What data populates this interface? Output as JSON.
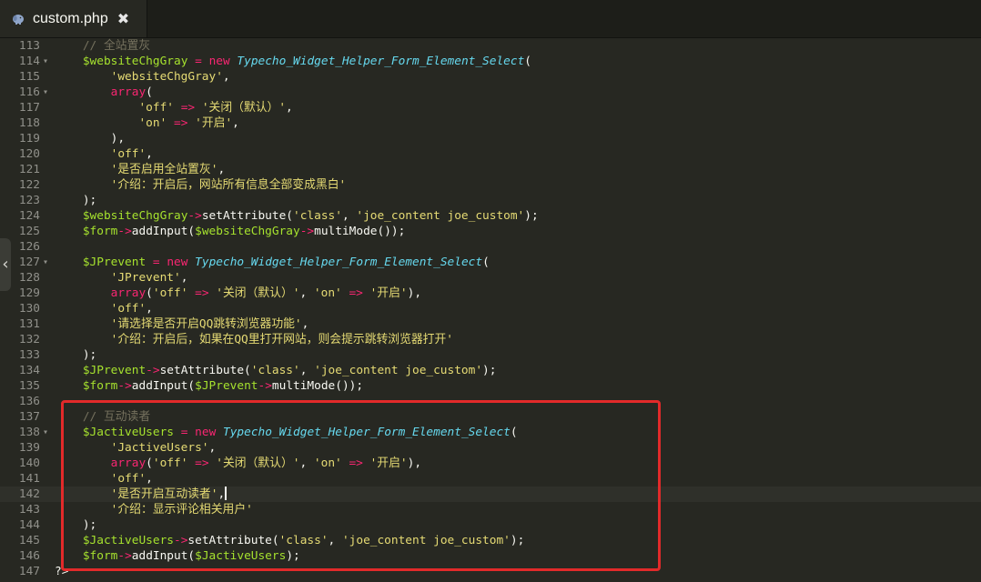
{
  "tab": {
    "title": "custom.php",
    "close": "✖",
    "icon": "php-elephant-icon"
  },
  "collapse_handle": "‹",
  "colors": {
    "background": "#272822",
    "comment": "#75715e",
    "variable": "#a6e22e",
    "keyword": "#f92672",
    "class": "#66d9ef",
    "string": "#e6db74",
    "highlight_box": "#e22a2a"
  },
  "highlight": {
    "from_line": 137,
    "to_line": 146
  },
  "cursor_line": 142,
  "lines": [
    {
      "num": "113",
      "fold": "",
      "tokens": [
        [
          "",
          "    "
        ],
        [
          "cmt",
          "// 全站置灰"
        ]
      ]
    },
    {
      "num": "114",
      "fold": "▾",
      "tokens": [
        [
          "",
          "    "
        ],
        [
          "var",
          "$websiteChgGray"
        ],
        [
          "",
          " "
        ],
        [
          "kw",
          "="
        ],
        [
          "",
          " "
        ],
        [
          "kw",
          "new"
        ],
        [
          "",
          " "
        ],
        [
          "cls",
          "Typecho_Widget_Helper_Form_Element_Select"
        ],
        [
          "",
          "("
        ]
      ]
    },
    {
      "num": "115",
      "fold": "",
      "tokens": [
        [
          "",
          "        "
        ],
        [
          "str",
          "'websiteChgGray'"
        ],
        [
          "",
          ","
        ]
      ]
    },
    {
      "num": "116",
      "fold": "▾",
      "tokens": [
        [
          "",
          "        "
        ],
        [
          "kw",
          "array"
        ],
        [
          "",
          "("
        ]
      ]
    },
    {
      "num": "117",
      "fold": "",
      "tokens": [
        [
          "",
          "            "
        ],
        [
          "str",
          "'off'"
        ],
        [
          "",
          " "
        ],
        [
          "kw",
          "=>"
        ],
        [
          "",
          " "
        ],
        [
          "str",
          "'关闭（默认）'"
        ],
        [
          "",
          ","
        ]
      ]
    },
    {
      "num": "118",
      "fold": "",
      "tokens": [
        [
          "",
          "            "
        ],
        [
          "str",
          "'on'"
        ],
        [
          "",
          " "
        ],
        [
          "kw",
          "=>"
        ],
        [
          "",
          " "
        ],
        [
          "str",
          "'开启'"
        ],
        [
          "",
          ","
        ]
      ]
    },
    {
      "num": "119",
      "fold": "",
      "tokens": [
        [
          "",
          "        "
        ],
        [
          "",
          "),"
        ]
      ]
    },
    {
      "num": "120",
      "fold": "",
      "tokens": [
        [
          "",
          "        "
        ],
        [
          "str",
          "'off'"
        ],
        [
          "",
          ","
        ]
      ]
    },
    {
      "num": "121",
      "fold": "",
      "tokens": [
        [
          "",
          "        "
        ],
        [
          "str",
          "'是否启用全站置灰'"
        ],
        [
          "",
          ","
        ]
      ]
    },
    {
      "num": "122",
      "fold": "",
      "tokens": [
        [
          "",
          "        "
        ],
        [
          "str",
          "'介绍：开启后，网站所有信息全部变成黑白'"
        ]
      ]
    },
    {
      "num": "123",
      "fold": "",
      "tokens": [
        [
          "",
          "    "
        ],
        [
          "",
          ");"
        ]
      ]
    },
    {
      "num": "124",
      "fold": "",
      "tokens": [
        [
          "",
          "    "
        ],
        [
          "var",
          "$websiteChgGray"
        ],
        [
          "kw",
          "->"
        ],
        [
          "fn",
          "setAttribute"
        ],
        [
          "",
          "("
        ],
        [
          "str",
          "'class'"
        ],
        [
          "",
          ", "
        ],
        [
          "str",
          "'joe_content joe_custom'"
        ],
        [
          "",
          ");"
        ]
      ]
    },
    {
      "num": "125",
      "fold": "",
      "tokens": [
        [
          "",
          "    "
        ],
        [
          "var",
          "$form"
        ],
        [
          "kw",
          "->"
        ],
        [
          "fn",
          "addInput"
        ],
        [
          "",
          "("
        ],
        [
          "var",
          "$websiteChgGray"
        ],
        [
          "kw",
          "->"
        ],
        [
          "fn",
          "multiMode"
        ],
        [
          "",
          "());"
        ]
      ]
    },
    {
      "num": "126",
      "fold": "",
      "tokens": [
        [
          "",
          ""
        ]
      ]
    },
    {
      "num": "127",
      "fold": "▾",
      "tokens": [
        [
          "",
          "    "
        ],
        [
          "var",
          "$JPrevent"
        ],
        [
          "",
          " "
        ],
        [
          "kw",
          "="
        ],
        [
          "",
          " "
        ],
        [
          "kw",
          "new"
        ],
        [
          "",
          " "
        ],
        [
          "cls",
          "Typecho_Widget_Helper_Form_Element_Select"
        ],
        [
          "",
          "("
        ]
      ]
    },
    {
      "num": "128",
      "fold": "",
      "tokens": [
        [
          "",
          "        "
        ],
        [
          "str",
          "'JPrevent'"
        ],
        [
          "",
          ","
        ]
      ]
    },
    {
      "num": "129",
      "fold": "",
      "tokens": [
        [
          "",
          "        "
        ],
        [
          "kw",
          "array"
        ],
        [
          "",
          "("
        ],
        [
          "str",
          "'off'"
        ],
        [
          "",
          " "
        ],
        [
          "kw",
          "=>"
        ],
        [
          "",
          " "
        ],
        [
          "str",
          "'关闭（默认）'"
        ],
        [
          "",
          ", "
        ],
        [
          "str",
          "'on'"
        ],
        [
          "",
          " "
        ],
        [
          "kw",
          "=>"
        ],
        [
          "",
          " "
        ],
        [
          "str",
          "'开启'"
        ],
        [
          "",
          "),"
        ]
      ]
    },
    {
      "num": "130",
      "fold": "",
      "tokens": [
        [
          "",
          "        "
        ],
        [
          "str",
          "'off'"
        ],
        [
          "",
          ","
        ]
      ]
    },
    {
      "num": "131",
      "fold": "",
      "tokens": [
        [
          "",
          "        "
        ],
        [
          "str",
          "'请选择是否开启QQ跳转浏览器功能'"
        ],
        [
          "",
          ","
        ]
      ]
    },
    {
      "num": "132",
      "fold": "",
      "tokens": [
        [
          "",
          "        "
        ],
        [
          "str",
          "'介绍：开启后，如果在QQ里打开网站，则会提示跳转浏览器打开'"
        ]
      ]
    },
    {
      "num": "133",
      "fold": "",
      "tokens": [
        [
          "",
          "    "
        ],
        [
          "",
          ");"
        ]
      ]
    },
    {
      "num": "134",
      "fold": "",
      "tokens": [
        [
          "",
          "    "
        ],
        [
          "var",
          "$JPrevent"
        ],
        [
          "kw",
          "->"
        ],
        [
          "fn",
          "setAttribute"
        ],
        [
          "",
          "("
        ],
        [
          "str",
          "'class'"
        ],
        [
          "",
          ", "
        ],
        [
          "str",
          "'joe_content joe_custom'"
        ],
        [
          "",
          ");"
        ]
      ]
    },
    {
      "num": "135",
      "fold": "",
      "tokens": [
        [
          "",
          "    "
        ],
        [
          "var",
          "$form"
        ],
        [
          "kw",
          "->"
        ],
        [
          "fn",
          "addInput"
        ],
        [
          "",
          "("
        ],
        [
          "var",
          "$JPrevent"
        ],
        [
          "kw",
          "->"
        ],
        [
          "fn",
          "multiMode"
        ],
        [
          "",
          "());"
        ]
      ]
    },
    {
      "num": "136",
      "fold": "",
      "tokens": [
        [
          "",
          ""
        ]
      ]
    },
    {
      "num": "137",
      "fold": "",
      "tokens": [
        [
          "",
          "    "
        ],
        [
          "cmt",
          "// 互动读者"
        ]
      ]
    },
    {
      "num": "138",
      "fold": "▾",
      "tokens": [
        [
          "",
          "    "
        ],
        [
          "var",
          "$JactiveUsers"
        ],
        [
          "",
          " "
        ],
        [
          "kw",
          "="
        ],
        [
          "",
          " "
        ],
        [
          "kw",
          "new"
        ],
        [
          "",
          " "
        ],
        [
          "cls",
          "Typecho_Widget_Helper_Form_Element_Select"
        ],
        [
          "",
          "("
        ]
      ]
    },
    {
      "num": "139",
      "fold": "",
      "tokens": [
        [
          "",
          "        "
        ],
        [
          "str",
          "'JactiveUsers'"
        ],
        [
          "",
          ","
        ]
      ]
    },
    {
      "num": "140",
      "fold": "",
      "tokens": [
        [
          "",
          "        "
        ],
        [
          "kw",
          "array"
        ],
        [
          "",
          "("
        ],
        [
          "str",
          "'off'"
        ],
        [
          "",
          " "
        ],
        [
          "kw",
          "=>"
        ],
        [
          "",
          " "
        ],
        [
          "str",
          "'关闭（默认）'"
        ],
        [
          "",
          ", "
        ],
        [
          "str",
          "'on'"
        ],
        [
          "",
          " "
        ],
        [
          "kw",
          "=>"
        ],
        [
          "",
          " "
        ],
        [
          "str",
          "'开启'"
        ],
        [
          "",
          "),"
        ]
      ]
    },
    {
      "num": "141",
      "fold": "",
      "tokens": [
        [
          "",
          "        "
        ],
        [
          "str",
          "'off'"
        ],
        [
          "",
          ","
        ]
      ]
    },
    {
      "num": "142",
      "fold": "",
      "tokens": [
        [
          "",
          "        "
        ],
        [
          "str",
          "'是否开启互动读者'"
        ],
        [
          "",
          ","
        ]
      ]
    },
    {
      "num": "143",
      "fold": "",
      "tokens": [
        [
          "",
          "        "
        ],
        [
          "str",
          "'介绍：显示评论相关用户'"
        ]
      ]
    },
    {
      "num": "144",
      "fold": "",
      "tokens": [
        [
          "",
          "    "
        ],
        [
          "",
          ");"
        ]
      ]
    },
    {
      "num": "145",
      "fold": "",
      "tokens": [
        [
          "",
          "    "
        ],
        [
          "var",
          "$JactiveUsers"
        ],
        [
          "kw",
          "->"
        ],
        [
          "fn",
          "setAttribute"
        ],
        [
          "",
          "("
        ],
        [
          "str",
          "'class'"
        ],
        [
          "",
          ", "
        ],
        [
          "str",
          "'joe_content joe_custom'"
        ],
        [
          "",
          ");"
        ]
      ]
    },
    {
      "num": "146",
      "fold": "",
      "tokens": [
        [
          "",
          "    "
        ],
        [
          "var",
          "$form"
        ],
        [
          "kw",
          "->"
        ],
        [
          "fn",
          "addInput"
        ],
        [
          "",
          "("
        ],
        [
          "var",
          "$JactiveUsers"
        ],
        [
          "",
          ");"
        ]
      ]
    },
    {
      "num": "147",
      "fold": "",
      "tokens": [
        [
          "",
          "?>"
        ]
      ]
    }
  ]
}
